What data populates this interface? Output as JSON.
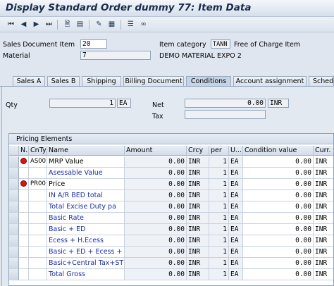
{
  "window": {
    "title": "Display Standard Order dummy 77: Item Data"
  },
  "toolbar": {
    "icons": [
      "first-page-icon",
      "previous-page-icon",
      "next-page-icon",
      "last-page-icon",
      "document-icon",
      "header-icon",
      "edit-icon",
      "overview-icon",
      "glasses-icon"
    ]
  },
  "header": {
    "sales_doc_item_label": "Sales Document Item",
    "sales_doc_item_value": "20",
    "item_category_label": "Item category",
    "item_category_value": "TANN",
    "item_category_text": "Free of Charge Item",
    "material_label": "Material",
    "material_value": "7",
    "material_text": "DEMO MATERIAL EXPO 2"
  },
  "tabs": [
    "Sales A",
    "Sales B",
    "Shipping",
    "Billing Document",
    "Conditions",
    "Account assignment",
    "Schedu"
  ],
  "active_tab": "Conditions",
  "conditions": {
    "qty_label": "Qty",
    "qty_value": "1",
    "qty_unit": "EA",
    "net_label": "Net",
    "net_value": "0.00",
    "net_currency": "INR",
    "tax_label": "Tax"
  },
  "pricing": {
    "title": "Pricing Elements",
    "columns": [
      "N..",
      "CnTy",
      "Name",
      "Amount",
      "Crcy",
      "per",
      "U...",
      "Condition value",
      "Curr."
    ],
    "rows": [
      {
        "status": "red",
        "cnty": "AS00",
        "name": "MRP Value",
        "amount": "0.00",
        "crcy": "INR",
        "per": "1",
        "uom": "EA",
        "cond_value": "0.00",
        "curr": "INR",
        "name_style": "black"
      },
      {
        "status": "",
        "cnty": "",
        "name": "Asessable Value",
        "amount": "0.00",
        "crcy": "INR",
        "per": "1",
        "uom": "EA",
        "cond_value": "0.00",
        "curr": "INR",
        "name_style": "blue"
      },
      {
        "status": "red",
        "cnty": "PR00",
        "name": "Price",
        "amount": "0.00",
        "crcy": "INR",
        "per": "1",
        "uom": "EA",
        "cond_value": "0.00",
        "curr": "INR",
        "name_style": "black"
      },
      {
        "status": "",
        "cnty": "",
        "name": "IN A/R BED total",
        "amount": "0.00",
        "crcy": "INR",
        "per": "1",
        "uom": "EA",
        "cond_value": "0.00",
        "curr": "INR",
        "name_style": "blue"
      },
      {
        "status": "",
        "cnty": "",
        "name": "Total Excise Duty pa",
        "amount": "0.00",
        "crcy": "INR",
        "per": "1",
        "uom": "EA",
        "cond_value": "0.00",
        "curr": "INR",
        "name_style": "blue"
      },
      {
        "status": "",
        "cnty": "",
        "name": "Basic Rate",
        "amount": "0.00",
        "crcy": "INR",
        "per": "1",
        "uom": "EA",
        "cond_value": "0.00",
        "curr": "INR",
        "name_style": "blue"
      },
      {
        "status": "",
        "cnty": "",
        "name": "Basic + ED",
        "amount": "0.00",
        "crcy": "INR",
        "per": "1",
        "uom": "EA",
        "cond_value": "0.00",
        "curr": "INR",
        "name_style": "blue"
      },
      {
        "status": "",
        "cnty": "",
        "name": "Ecess + H.Ecess",
        "amount": "0.00",
        "crcy": "INR",
        "per": "1",
        "uom": "EA",
        "cond_value": "0.00",
        "curr": "INR",
        "name_style": "blue"
      },
      {
        "status": "",
        "cnty": "",
        "name": "Basic + ED + Ecess +",
        "amount": "0.00",
        "crcy": "INR",
        "per": "1",
        "uom": "EA",
        "cond_value": "0.00",
        "curr": "INR",
        "name_style": "blue"
      },
      {
        "status": "",
        "cnty": "",
        "name": "Basic+Central Tax+ST",
        "amount": "0.00",
        "crcy": "INR",
        "per": "1",
        "uom": "EA",
        "cond_value": "0.00",
        "curr": "INR",
        "name_style": "blue"
      },
      {
        "status": "",
        "cnty": "",
        "name": "Total Gross",
        "amount": "0.00",
        "crcy": "INR",
        "per": "1",
        "uom": "EA",
        "cond_value": "0.00",
        "curr": "INR",
        "name_style": "blue"
      }
    ]
  },
  "colors": {
    "link_blue": "#1b2ea8",
    "status_red": "#e01212"
  }
}
